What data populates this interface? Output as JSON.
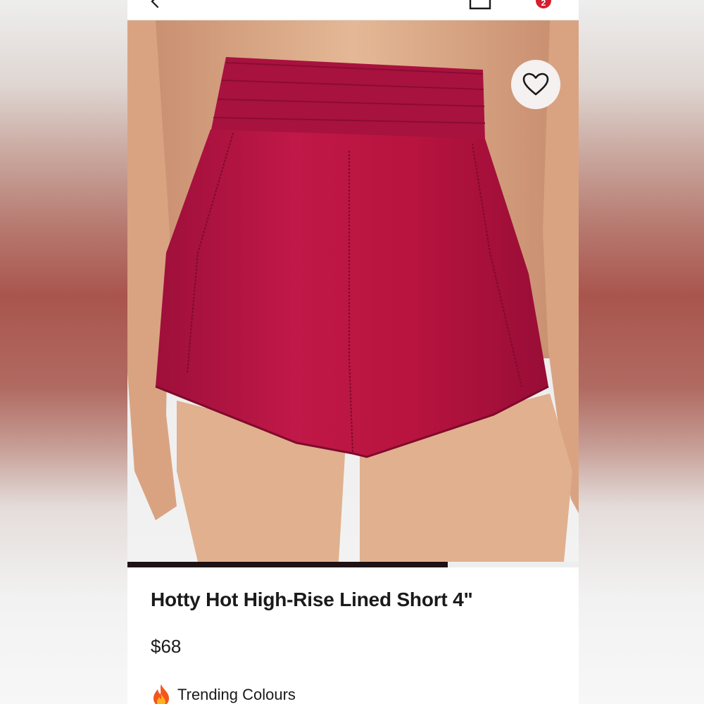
{
  "header": {
    "back_icon": "chevron-left-icon",
    "bag_icon": "shopping-bag-icon",
    "cart_count": "2",
    "badge_color": "#d31f2f"
  },
  "gallery": {
    "image_subject": "shorts-photo",
    "favorite_icon": "heart-icon",
    "progress": 0.71,
    "progress_color": "#1e1215"
  },
  "product": {
    "title": "Hotty Hot High-Rise Lined Short 4\"",
    "price": "$68"
  },
  "trending": {
    "icon": "fire-icon",
    "label": "Trending Colours"
  }
}
